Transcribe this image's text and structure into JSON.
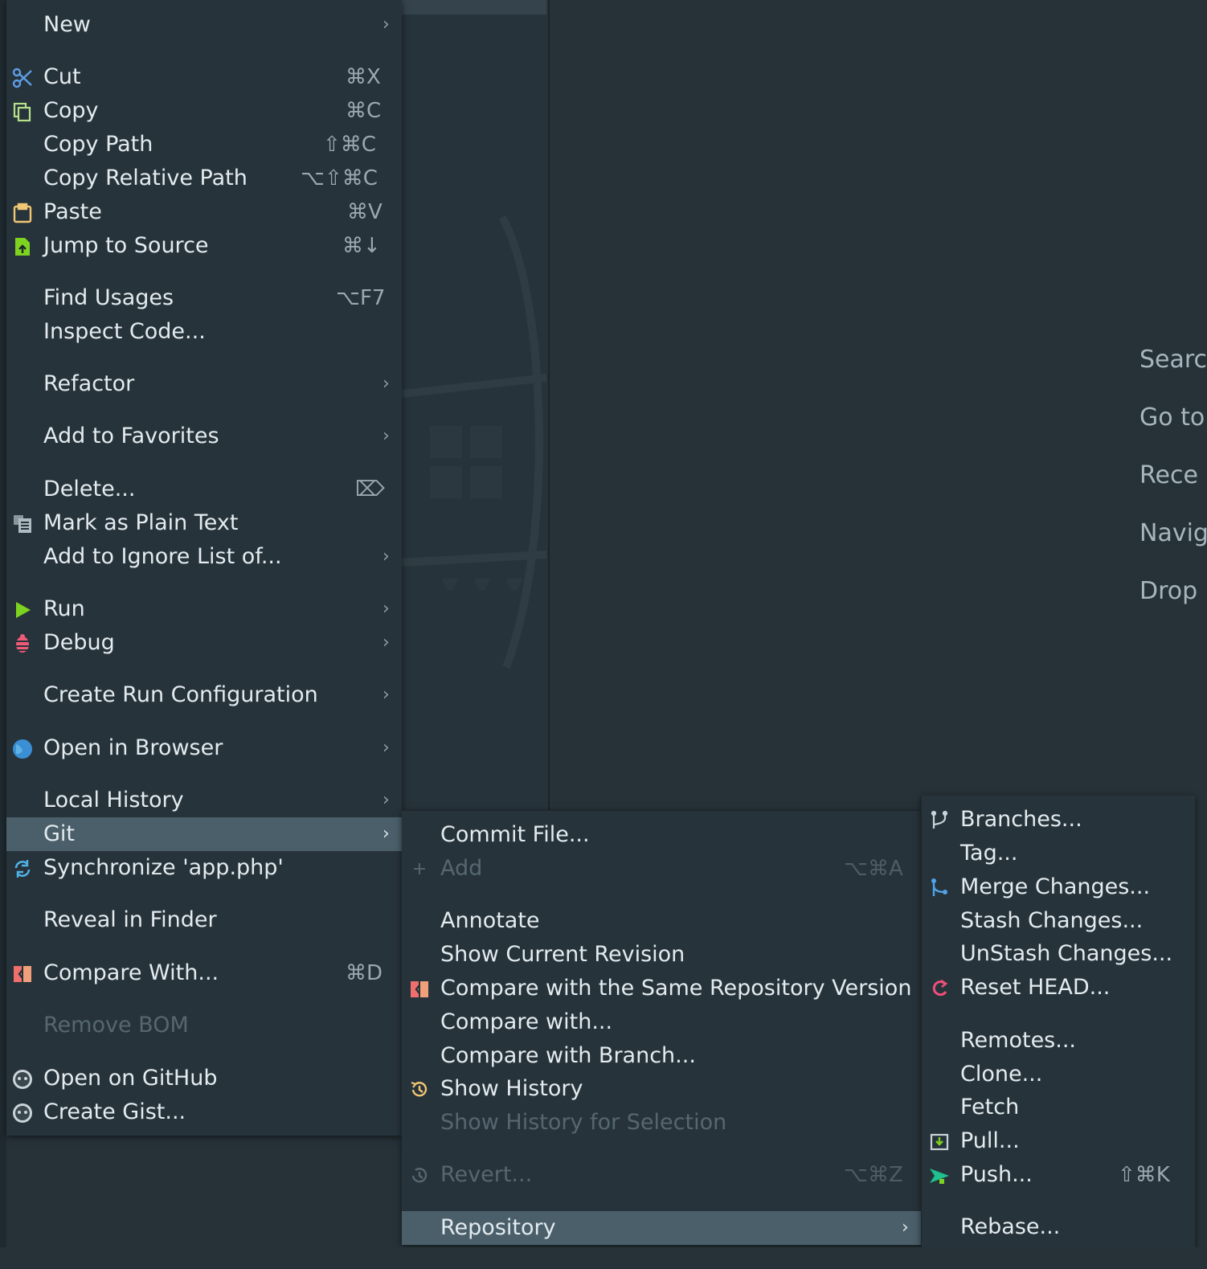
{
  "editor": {
    "hints": [
      "Searc",
      "Go to",
      "Rece",
      "Navig",
      "Drop"
    ]
  },
  "main_menu": {
    "items": [
      {
        "label": "New",
        "shortcut": "",
        "submenu": true
      },
      {
        "label": "Cut",
        "shortcut": "⌘X",
        "icon": "scissors-icon"
      },
      {
        "label": "Copy",
        "shortcut": "⌘C",
        "icon": "copy-icon"
      },
      {
        "label": "Copy Path",
        "shortcut": "⇧⌘C"
      },
      {
        "label": "Copy Relative Path",
        "shortcut": "⌥⇧⌘C"
      },
      {
        "label": "Paste",
        "shortcut": "⌘V",
        "icon": "clipboard-icon"
      },
      {
        "label": "Jump to Source",
        "shortcut": "⌘↓",
        "icon": "jump-to-source-icon"
      },
      {
        "label": "Find Usages",
        "shortcut": "⌥F7"
      },
      {
        "label": "Inspect Code..."
      },
      {
        "label": "Refactor",
        "submenu": true
      },
      {
        "label": "Add to Favorites",
        "submenu": true
      },
      {
        "label": "Delete...",
        "shortcut": "⌦"
      },
      {
        "label": "Mark as Plain Text",
        "icon": "plain-text-icon"
      },
      {
        "label": "Add to Ignore List of...",
        "submenu": true
      },
      {
        "label": "Run",
        "submenu": true,
        "icon": "run-icon"
      },
      {
        "label": "Debug",
        "submenu": true,
        "icon": "bug-icon"
      },
      {
        "label": "Create Run Configuration",
        "submenu": true
      },
      {
        "label": "Open in Browser",
        "submenu": true,
        "icon": "globe-icon"
      },
      {
        "label": "Local History",
        "submenu": true
      },
      {
        "label": "Git",
        "submenu": true,
        "selected": true
      },
      {
        "label": "Synchronize 'app.php'",
        "icon": "sync-icon"
      },
      {
        "label": "Reveal in Finder"
      },
      {
        "label": "Compare With...",
        "shortcut": "⌘D",
        "icon": "compare-icon"
      },
      {
        "label": "Remove BOM",
        "disabled": true
      },
      {
        "label": "Open on GitHub",
        "icon": "github-icon"
      },
      {
        "label": "Create Gist...",
        "icon": "github-icon"
      }
    ]
  },
  "git_menu": {
    "items": [
      {
        "label": "Commit File..."
      },
      {
        "label": "Add",
        "shortcut": "⌥⌘A",
        "disabled": true,
        "icon": "plus-icon"
      },
      {
        "label": "Annotate"
      },
      {
        "label": "Show Current Revision"
      },
      {
        "label": "Compare with the Same Repository Version",
        "icon": "compare-icon"
      },
      {
        "label": "Compare with..."
      },
      {
        "label": "Compare with Branch..."
      },
      {
        "label": "Show History",
        "icon": "history-icon"
      },
      {
        "label": "Show History for Selection",
        "disabled": true
      },
      {
        "label": "Revert...",
        "shortcut": "⌥⌘Z",
        "disabled": true,
        "icon": "revert-icon"
      },
      {
        "label": "Repository",
        "submenu": true,
        "selected": true
      }
    ]
  },
  "repo_menu": {
    "items": [
      {
        "label": "Branches...",
        "icon": "branches-icon"
      },
      {
        "label": "Tag..."
      },
      {
        "label": "Merge Changes...",
        "icon": "merge-icon"
      },
      {
        "label": "Stash Changes..."
      },
      {
        "label": "UnStash Changes..."
      },
      {
        "label": "Reset HEAD...",
        "icon": "reset-icon"
      },
      {
        "label": "Remotes..."
      },
      {
        "label": "Clone..."
      },
      {
        "label": "Fetch"
      },
      {
        "label": "Pull...",
        "icon": "pull-icon"
      },
      {
        "label": "Push...",
        "shortcut": "⇧⌘K",
        "icon": "push-icon"
      },
      {
        "label": "Rebase..."
      }
    ]
  },
  "colors": {
    "background": "#263238",
    "menu_bg": "#27333a",
    "selected_bg": "#4b5f6a",
    "text": "#e3ebef",
    "disabled_text": "#56676f"
  }
}
